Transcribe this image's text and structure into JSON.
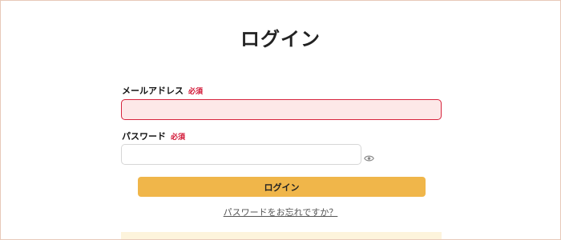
{
  "page": {
    "title": "ログイン"
  },
  "form": {
    "email": {
      "label": "メールアドレス",
      "required_badge": "必須",
      "value": "",
      "state": "error"
    },
    "password": {
      "label": "パスワード",
      "required_badge": "必須",
      "value": "",
      "toggle_icon": "eye-icon"
    },
    "submit_label": "ログイン",
    "forgot_link": "パスワードをお忘れですか？"
  },
  "colors": {
    "accent_button": "#f0b64a",
    "error_border": "#d7243d",
    "error_fill": "#fde8e8",
    "required": "#d10f2f",
    "frame_border": "#e8c9b9"
  }
}
